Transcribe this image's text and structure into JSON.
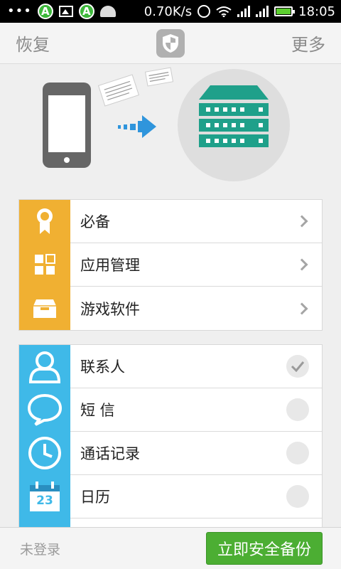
{
  "status_bar": {
    "network_speed": "0.70K/s",
    "time": "18:05",
    "notif_letter": "A"
  },
  "action_bar": {
    "restore_label": "恢复",
    "more_label": "更多"
  },
  "apps_group": {
    "items": [
      {
        "label": "必备",
        "icon": "ribbon-badge-icon"
      },
      {
        "label": "应用管理",
        "icon": "grid-apps-icon"
      },
      {
        "label": "游戏软件",
        "icon": "inbox-tray-icon"
      }
    ]
  },
  "data_group": {
    "items": [
      {
        "label": "联系人",
        "icon": "contact-person-icon",
        "selected": true
      },
      {
        "label": "短 信",
        "icon": "chat-bubble-icon",
        "selected": false
      },
      {
        "label": "通话记录",
        "icon": "clock-icon",
        "selected": false
      },
      {
        "label": "日历",
        "icon": "calendar-icon",
        "selected": false,
        "calendar_day": "23"
      }
    ]
  },
  "bottom_bar": {
    "login_label": "未登录",
    "backup_button": "立即安全备份"
  },
  "colors": {
    "accent_yellow": "#f0b032",
    "accent_blue": "#3fb9e8",
    "button_green": "#4cae33",
    "server_teal": "#1fa08a"
  }
}
